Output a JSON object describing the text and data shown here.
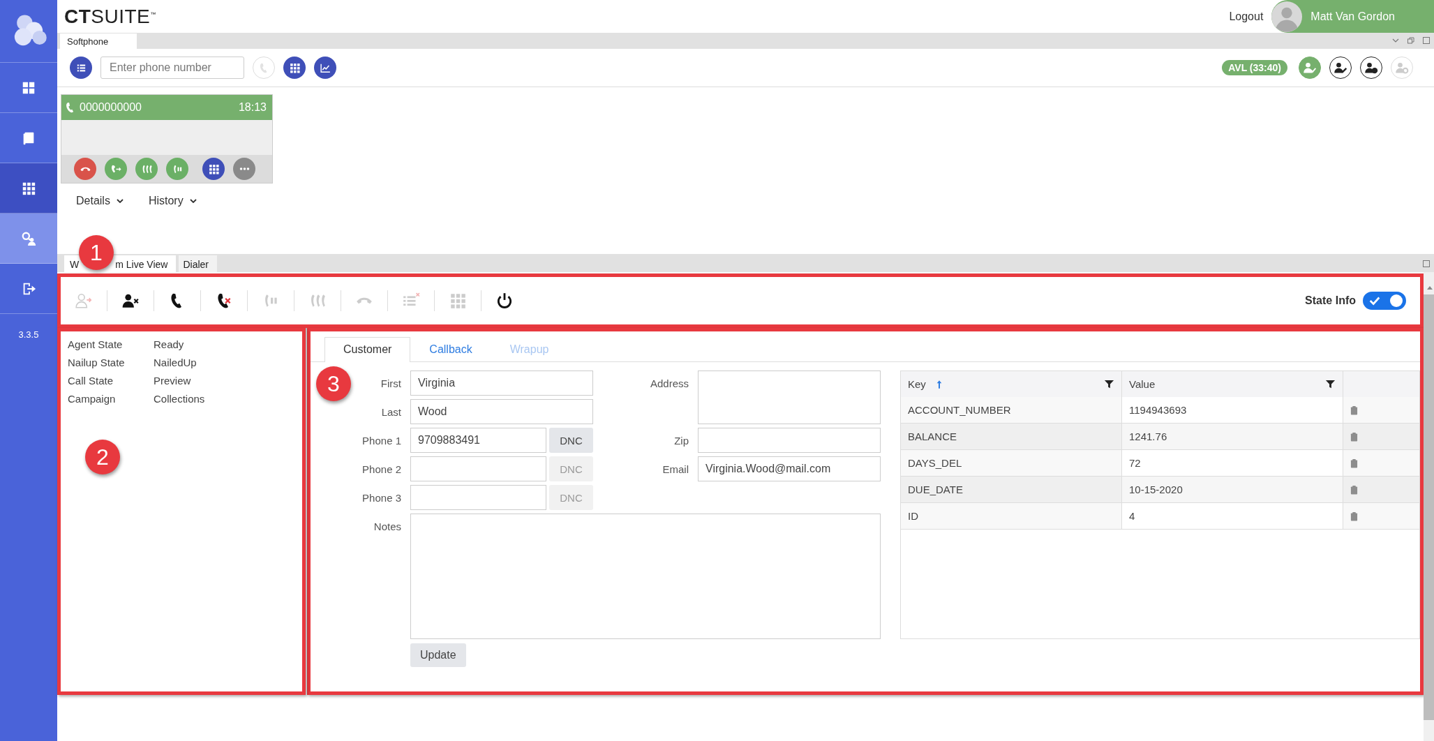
{
  "app": {
    "logo": "**CT**SUITE$^{™}$"
  },
  "header": {
    "logout": "Logout",
    "user": "Matt Van Gordon"
  },
  "sidebar": {
    "items": [
      {
        "kind": "dashboard",
        "selected": false,
        "hovered": false
      },
      {
        "kind": "book",
        "selected": false,
        "hovered": false
      },
      {
        "kind": "apps",
        "selected": true,
        "hovered": false
      },
      {
        "kind": "agents",
        "selected": false,
        "hovered": true
      },
      {
        "kind": "exit",
        "selected": false,
        "hovered": false
      }
    ],
    "version": "3.3.5"
  },
  "softphone": {
    "tab": "Softphone",
    "phone_field": {
      "placeholder": "Enter phone number"
    },
    "tools": [
      {
        "kind": "list",
        "disabled": false
      },
      {
        "kind": "dial",
        "disabled": true
      },
      {
        "kind": "keypad",
        "disabled": false
      },
      {
        "kind": "chart",
        "disabled": false
      }
    ],
    "status": "AVL (33:40)",
    "agent_buttons": [
      {
        "kind": "ready",
        "disabled": false
      },
      {
        "kind": "edit",
        "disabled": false
      },
      {
        "kind": "clock",
        "disabled": false
      },
      {
        "kind": "settings",
        "disabled": true
      }
    ],
    "call": {
      "number": "0000000000",
      "time": "18:13"
    },
    "call_buttons": [
      {
        "kind": "hangup"
      },
      {
        "kind": "transfer"
      },
      {
        "kind": "conference"
      },
      {
        "kind": "hold"
      },
      {
        "kind": "keypad"
      },
      {
        "kind": "more"
      }
    ],
    "links": [
      "Details",
      "History"
    ]
  },
  "lower": {
    "tabs": [
      {
        "label_start": "W",
        "label_end": "m Live View",
        "selected": true
      },
      {
        "label": "Dialer",
        "selected": false
      }
    ],
    "toolbar": [
      {
        "kind": "agent-forward",
        "disabled": true
      },
      {
        "kind": "agent-remove",
        "disabled": false
      },
      {
        "kind": "call",
        "disabled": false
      },
      {
        "kind": "call-cancel",
        "disabled": false
      },
      {
        "kind": "hold",
        "disabled": true
      },
      {
        "kind": "conference",
        "disabled": true
      },
      {
        "kind": "hangup",
        "disabled": true
      },
      {
        "kind": "queue-clear",
        "disabled": true
      },
      {
        "kind": "keypad",
        "disabled": true
      },
      {
        "kind": "power",
        "disabled": false
      }
    ],
    "state_info": {
      "label": "State Info",
      "on": true
    },
    "agent_info": [
      {
        "label": "Agent State",
        "value": "Ready"
      },
      {
        "label": "Nailup State",
        "value": "NailedUp"
      },
      {
        "label": "Call State",
        "value": "Preview"
      },
      {
        "label": "Campaign",
        "value": "Collections"
      }
    ],
    "form_tabs": [
      {
        "label": "Customer",
        "selected": true,
        "disabled": false
      },
      {
        "label": "Callback",
        "selected": false,
        "disabled": false
      },
      {
        "label": "Wrapup",
        "selected": false,
        "disabled": true
      }
    ],
    "form": {
      "first": {
        "label": "First",
        "value": "Virginia"
      },
      "last": {
        "label": "Last",
        "value": "Wood"
      },
      "phones": [
        {
          "label": "Phone 1",
          "value": "9709883491",
          "dnc": {
            "label": "DNC",
            "disabled": false
          }
        },
        {
          "label": "Phone 2",
          "dnc": {
            "label": "DNC",
            "disabled": true
          }
        },
        {
          "label": "Phone 3",
          "dnc": {
            "label": "DNC",
            "disabled": true
          }
        }
      ],
      "address": {
        "label": "Address"
      },
      "zip": {
        "label": "Zip"
      },
      "email": {
        "label": "Email",
        "value": "Virginia.Wood@mail.com"
      },
      "notes": {
        "label": "Notes"
      },
      "update": "Update"
    },
    "table": {
      "columns": [
        "Key",
        "Value"
      ],
      "rows": [
        {
          "key": "ACCOUNT_NUMBER",
          "value": "1194943693"
        },
        {
          "key": "BALANCE",
          "value": "1241.76"
        },
        {
          "key": "DAYS_DEL",
          "value": "72"
        },
        {
          "key": "DUE_DATE",
          "value": "10-15-2020"
        },
        {
          "key": "ID",
          "value": "4"
        }
      ]
    }
  },
  "callouts": [
    "1",
    "2",
    "3"
  ]
}
